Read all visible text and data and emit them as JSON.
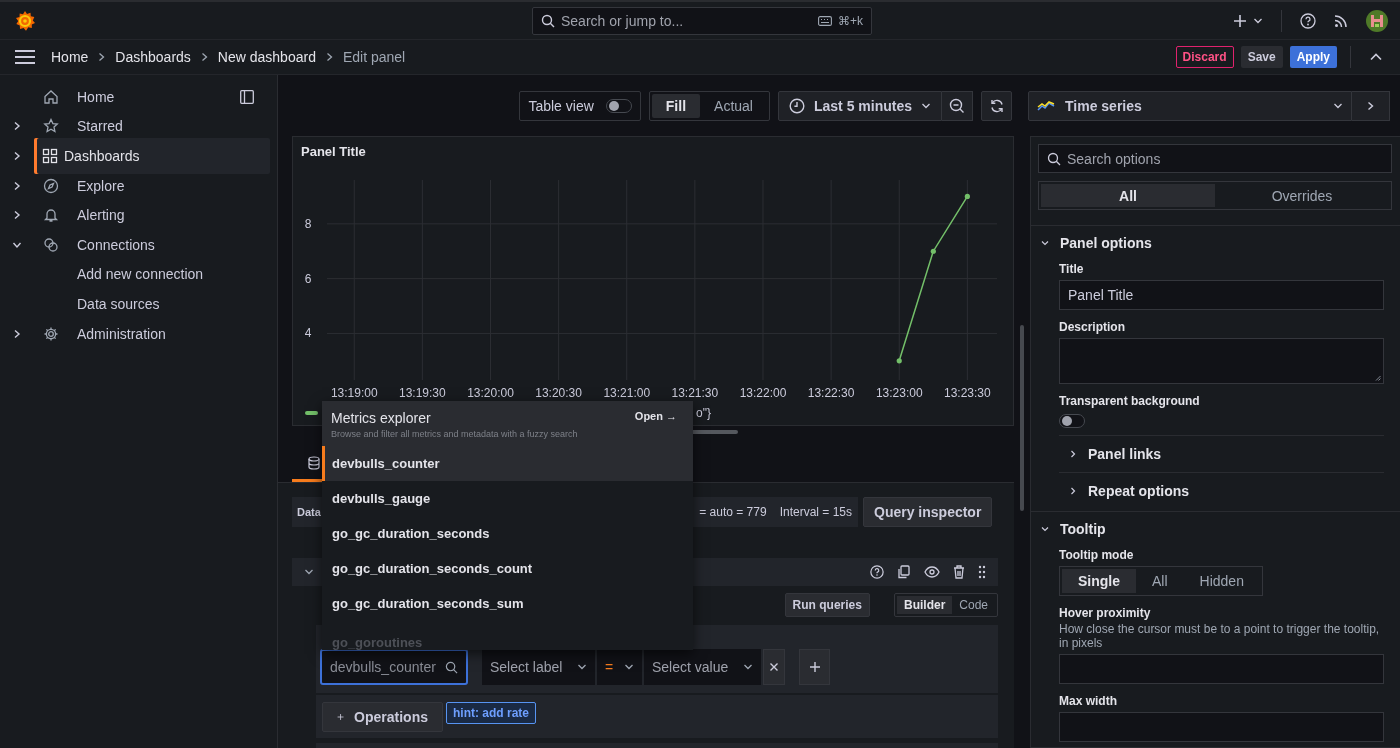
{
  "topbar": {
    "search": {
      "placeholder": "Search or jump to..."
    },
    "shortcut": "⌘+k"
  },
  "breadcrumbs": [
    {
      "label": "Home",
      "current": false
    },
    {
      "label": "Dashboards",
      "current": false
    },
    {
      "label": "New dashboard",
      "current": false
    },
    {
      "label": "Edit panel",
      "current": true
    }
  ],
  "actions": [
    {
      "label": "Discard",
      "kind": "danger"
    },
    {
      "label": "Save",
      "kind": "secondary"
    },
    {
      "label": "Apply",
      "kind": "primary"
    }
  ],
  "sidebar": {
    "items": [
      {
        "label": "Home",
        "kind": "home",
        "selected": false
      },
      {
        "label": "Starred",
        "kind": "star",
        "expanded": false,
        "selected": false
      },
      {
        "label": "Dashboards",
        "kind": "grid",
        "expanded": false,
        "selected": true
      },
      {
        "label": "Explore",
        "kind": "compass",
        "expanded": false,
        "selected": false
      },
      {
        "label": "Alerting",
        "kind": "bell",
        "expanded": false,
        "selected": false
      },
      {
        "label": "Connections",
        "kind": "link",
        "expanded": true,
        "selected": false,
        "children": [
          {
            "label": "Add new connection",
            "selected": false
          },
          {
            "label": "Data sources",
            "selected": false
          }
        ]
      },
      {
        "label": "Administration",
        "kind": "gear",
        "expanded": false,
        "selected": false
      }
    ]
  },
  "toolbar": {
    "table_view": {
      "label": "Table view",
      "on": false
    },
    "size_modes": [
      {
        "label": "Fill",
        "selected": true
      },
      {
        "label": "Actual",
        "selected": false
      }
    ],
    "time_range": "Last 5 minutes"
  },
  "panel": {
    "title": "Panel Title",
    "chart_data": {
      "type": "line",
      "categories": [
        "13:19:00",
        null,
        "13:19:30",
        null,
        "13:20:00",
        null,
        "13:20:30",
        null,
        "13:21:00",
        null,
        "13:21:30",
        null,
        "13:22:00",
        null,
        "13:22:30",
        null,
        "13:23:00",
        null,
        "13:23:30"
      ],
      "series": [
        {
          "name": "o\"}",
          "color": "#73bf69",
          "values": [
            null,
            null,
            null,
            null,
            null,
            null,
            null,
            null,
            null,
            null,
            null,
            null,
            null,
            null,
            null,
            null,
            3,
            7,
            9
          ]
        }
      ],
      "ylim": [
        2.3,
        9.6
      ],
      "grid": true,
      "yticks": [
        4,
        6,
        8
      ]
    }
  },
  "query": {
    "options": [
      "Data",
      "= auto = 779",
      "Interval = 15s"
    ],
    "inspector": "Query inspector",
    "run": "Run queries",
    "editor_modes": [
      {
        "label": "Builder",
        "selected": true
      },
      {
        "label": "Code",
        "selected": false
      }
    ],
    "metric": {
      "placeholder": "devbulls_counter"
    },
    "label_filter": {
      "label": {
        "placeholder": "Select label"
      },
      "operator": "=",
      "value": {
        "placeholder": "Select value"
      }
    },
    "operations": "Operations",
    "hint": "hint: add rate"
  },
  "metrics_explorer": {
    "title": "Metrics explorer",
    "open": "Open →",
    "subtitle": "Browse and filter all metrics and metadata with a fuzzy search",
    "items": [
      {
        "label": "devbulls_counter",
        "selected": true
      },
      {
        "label": "devbulls_gauge",
        "selected": false
      },
      {
        "label": "go_gc_duration_seconds",
        "selected": false
      },
      {
        "label": "go_gc_duration_seconds_count",
        "selected": false
      },
      {
        "label": "go_gc_duration_seconds_sum",
        "selected": false
      },
      {
        "label": "go_goroutines",
        "selected": false
      }
    ]
  },
  "visualization": {
    "label": "Time series"
  },
  "options": {
    "search": {
      "placeholder": "Search options"
    },
    "tabs": [
      {
        "label": "All",
        "selected": true
      },
      {
        "label": "Overrides",
        "selected": false
      }
    ],
    "sections": [
      {
        "title": "Panel options",
        "expanded": true,
        "fields": [
          {
            "kind": "text",
            "label": "Title",
            "value": "Panel Title"
          },
          {
            "kind": "textarea",
            "label": "Description"
          },
          {
            "kind": "switch",
            "label": "Transparent background",
            "on": false
          }
        ],
        "subsections": [
          {
            "title": "Panel links",
            "expanded": false
          },
          {
            "title": "Repeat options",
            "expanded": false
          }
        ]
      },
      {
        "title": "Tooltip",
        "expanded": true,
        "fields": [
          {
            "kind": "radio",
            "label": "Tooltip mode",
            "options": [
              {
                "label": "Single",
                "selected": true
              },
              {
                "label": "All",
                "selected": false
              },
              {
                "label": "Hidden",
                "selected": false
              }
            ]
          },
          {
            "kind": "text",
            "label": "Hover proximity",
            "description": "How close the cursor must be to a point to trigger the tooltip, in pixels"
          },
          {
            "kind": "text",
            "label": "Max width"
          }
        ]
      }
    ]
  }
}
